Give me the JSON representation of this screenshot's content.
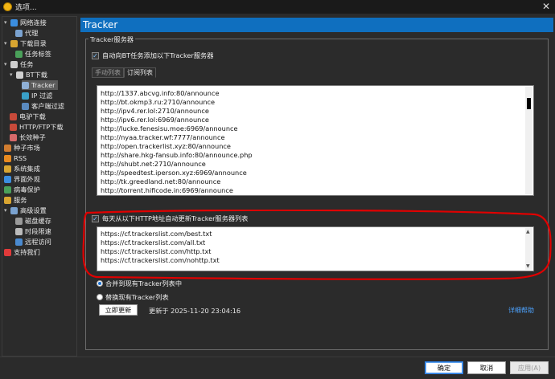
{
  "window": {
    "title": "选项..."
  },
  "tree": {
    "items": [
      {
        "label": "网络连接",
        "icon": "network-icon",
        "color": "#3b8ee0",
        "exp": "⊟"
      },
      {
        "label": "代理",
        "icon": "proxy-icon",
        "color": "#7aa2d0"
      },
      {
        "label": "下载目录",
        "icon": "folder-icon",
        "color": "#d9a531",
        "exp": "⊟"
      },
      {
        "label": "任务标签",
        "icon": "tag-icon",
        "color": "#4aa05a"
      },
      {
        "label": "任务",
        "icon": "task-icon",
        "color": "#cfcfcf",
        "exp": "⊟"
      },
      {
        "label": "BT下载",
        "icon": "bt-icon",
        "color": "#d0d0d0",
        "exp": "⊟"
      },
      {
        "label": "Tracker",
        "icon": "tracker-icon",
        "color": "#8fb0d6",
        "selected": true
      },
      {
        "label": "IP 过滤",
        "icon": "ip-filter-icon",
        "color": "#39a0c8"
      },
      {
        "label": "客户端过滤",
        "icon": "client-filter-icon",
        "color": "#5a8ac0"
      },
      {
        "label": "电驴下载",
        "icon": "edonkey-icon",
        "color": "#c84a3a"
      },
      {
        "label": "HTTP/FTP下载",
        "icon": "http-icon",
        "color": "#c84a3a"
      },
      {
        "label": "长效种子",
        "icon": "seed-icon",
        "color": "#d66a6a"
      },
      {
        "label": "种子市场",
        "icon": "market-icon",
        "color": "#d07c30"
      },
      {
        "label": "RSS",
        "icon": "rss-icon",
        "color": "#e88a20"
      },
      {
        "label": "系统集成",
        "icon": "integration-icon",
        "color": "#d9a531"
      },
      {
        "label": "界面外观",
        "icon": "appearance-icon",
        "color": "#3b8ee0"
      },
      {
        "label": "病毒保护",
        "icon": "virus-shield-icon",
        "color": "#4aa05a"
      },
      {
        "label": "服务",
        "icon": "service-icon",
        "color": "#d9a531"
      },
      {
        "label": "高级设置",
        "icon": "advanced-icon",
        "color": "#7aa2d0",
        "exp": "⊟"
      },
      {
        "label": "磁盘缓存",
        "icon": "disk-cache-icon",
        "color": "#9a9a9a"
      },
      {
        "label": "时段限速",
        "icon": "schedule-icon",
        "color": "#bbbbbb"
      },
      {
        "label": "远程访问",
        "icon": "remote-icon",
        "color": "#4a8ad0"
      },
      {
        "label": "支持我们",
        "icon": "heart-icon",
        "color": "#e03a3a"
      }
    ]
  },
  "header": {
    "title": "Tracker"
  },
  "group": {
    "label": "Tracker服务器"
  },
  "auto_add": {
    "label": "自动向BT任务添加以下Tracker服务器",
    "checked": true
  },
  "tabs": [
    {
      "label": "手动列表",
      "active": false
    },
    {
      "label": "订阅列表",
      "active": true
    }
  ],
  "trackers": [
    "http://1337.abcvg.info:80/announce",
    "http://bt.okmp3.ru:2710/announce",
    "http://ipv4.rer.lol:2710/announce",
    "http://ipv6.rer.lol:6969/announce",
    "http://lucke.fenesisu.moe:6969/announce",
    "http://nyaa.tracker.wf:7777/announce",
    "http://open.trackerlist.xyz:80/announce",
    "http://share.hkg-fansub.info:80/announce.php",
    "http://shubt.net:2710/announce",
    "http://speedtest.iperson.xyz:6969/announce",
    "http://tk.greedland.net:80/announce",
    "http://torrent.hificode.in:6969/announce"
  ],
  "daily_update": {
    "label": "每天从以下HTTP地址自动更新Tracker服务器列表",
    "checked": true
  },
  "sub_urls": [
    "https://cf.trackerslist.com/best.txt",
    "https://cf.trackerslist.com/all.txt",
    "https://cf.trackerslist.com/http.txt",
    "https://cf.trackerslist.com/nohttp.txt"
  ],
  "merge_mode": {
    "merge_label": "合并到现有Tracker列表中",
    "replace_label": "替换现有Tracker列表",
    "selected": "merge"
  },
  "update_now": {
    "label": "立即更新"
  },
  "updated": {
    "text": "更新于 2025-11-20 23:04:16"
  },
  "help": {
    "label": "详细帮助"
  },
  "buttons": {
    "ok": "确定",
    "cancel": "取消",
    "apply": "应用(A)"
  },
  "colors": {
    "accent": "#0f6fbf",
    "annotation": "#e00000",
    "link": "#4da3ff"
  }
}
